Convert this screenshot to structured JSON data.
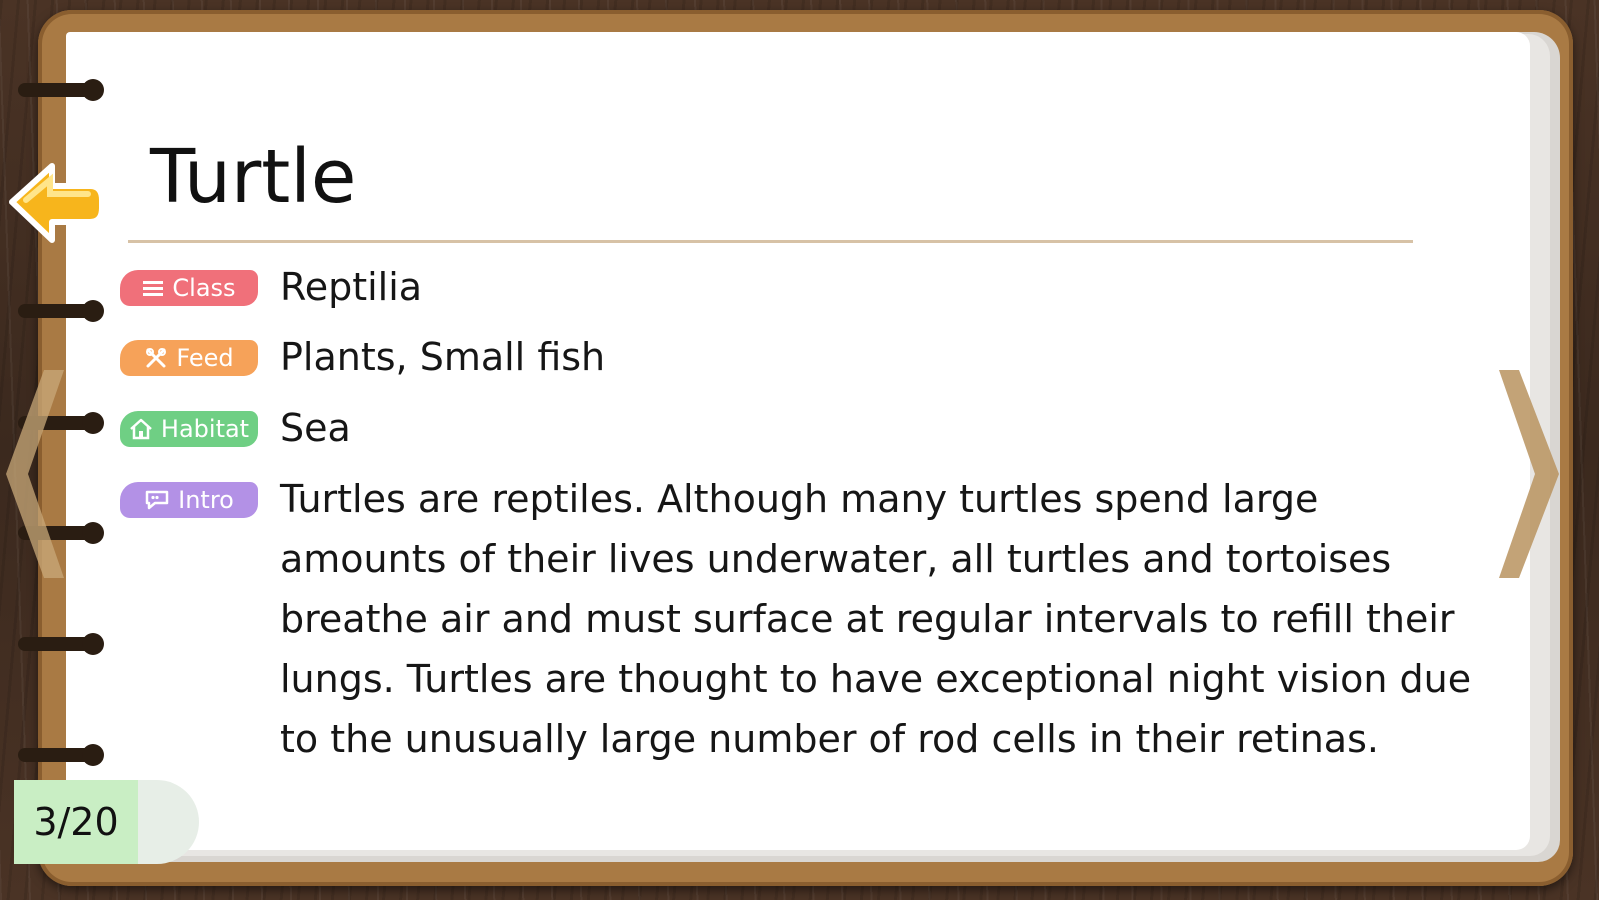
{
  "entry": {
    "title": "Turtle"
  },
  "info": {
    "class": {
      "tag_label": "Class",
      "value": "Reptilia",
      "color": "#f0707a"
    },
    "feed": {
      "tag_label": "Feed",
      "value": "Plants, Small fish",
      "color": "#f6a259"
    },
    "habitat": {
      "tag_label": "Habitat",
      "value": "Sea",
      "color": "#6fcf84"
    },
    "intro": {
      "tag_label": "Intro",
      "value": "Turtles are reptiles. Although many turtles spend large amounts of their lives underwater, all turtles and tortoises breathe air and must surface at regular intervals to refill their lungs. Turtles are thought to have exceptional night vision due to the unusually large number of rod cells in their retinas.",
      "color": "#b391e6"
    }
  },
  "pager": {
    "counter": "3/20",
    "prev_icon": "chevron-left-icon",
    "next_icon": "chevron-right-icon"
  },
  "controls": {
    "back_icon": "arrow-left-icon"
  },
  "theme": {
    "cover": "#a97a44",
    "page": "#ffffff",
    "rule": "#d7c2a6",
    "back_button": "#f7b51c"
  }
}
